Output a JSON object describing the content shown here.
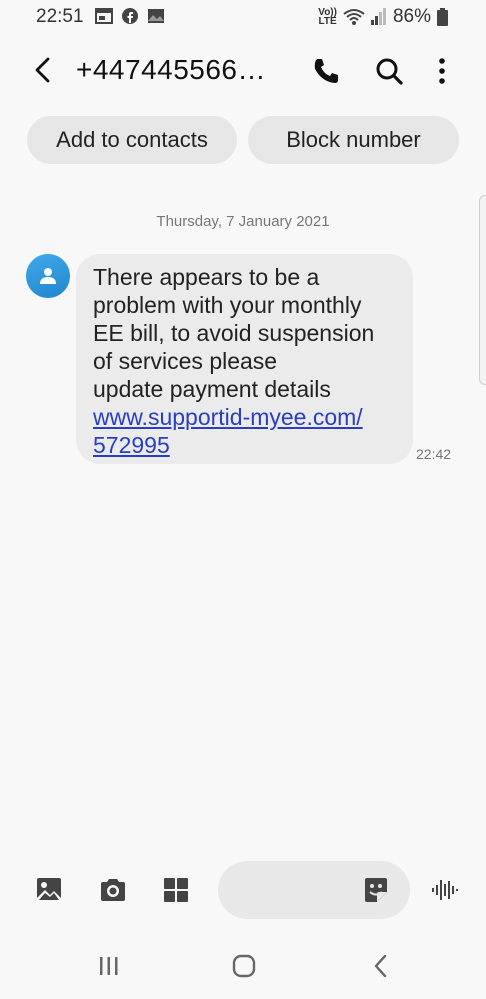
{
  "status": {
    "time": "22:51",
    "battery": "86%",
    "network_label_top": "Vo))",
    "network_label_bottom": "LTE",
    "icons_left": [
      "calendar-icon",
      "facebook-icon",
      "photos-icon"
    ],
    "icons_right": [
      "volte-icon",
      "wifi-icon",
      "signal-icon",
      "battery-icon"
    ]
  },
  "header": {
    "contact": "+447445566…",
    "actions": [
      "call-icon",
      "search-icon",
      "more-options-icon"
    ]
  },
  "chips": {
    "add": "Add to contacts",
    "block": "Block number"
  },
  "conversation": {
    "date": "Thursday, 7 January 2021",
    "message": {
      "lines": [
        "There appears to be a",
        "problem with your monthly",
        "EE bill, to avoid suspension",
        "of services please",
        "update payment details"
      ],
      "link_line1": "www.supportid-myee.com/",
      "link_line2": "572995",
      "time": "22:42"
    }
  },
  "composer": {
    "icons": [
      "gallery-icon",
      "camera-icon",
      "apps-grid-icon",
      "sticker-icon",
      "voice-icon"
    ],
    "placeholder": ""
  },
  "navigation": {
    "buttons": [
      "recent-apps-icon",
      "home-icon",
      "back-icon"
    ]
  },
  "colors": {
    "background": "#f8f8f8",
    "bubble": "#ebebeb",
    "chip": "#e6e6e6",
    "link": "#2a3ec4",
    "avatar": "#2a95db"
  }
}
